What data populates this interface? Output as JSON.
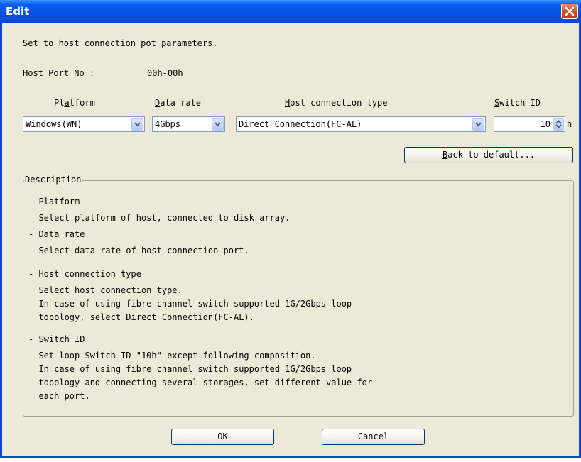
{
  "window": {
    "title": "Edit"
  },
  "instructions": "Set to host connection pot parameters.",
  "host_port": {
    "label": "Host Port No :",
    "value": "00h-00h"
  },
  "platform": {
    "label_pre": "Pl",
    "label_u": "a",
    "label_post": "tform",
    "value": "Windows(WN)"
  },
  "data_rate": {
    "label_u": "D",
    "label_post": "ata rate",
    "value": "4Gbps"
  },
  "host_connection_type": {
    "label_u": "H",
    "label_post": "ost connection type",
    "value": "Direct Connection(FC-AL)"
  },
  "switch_id": {
    "label_u": "S",
    "label_post": "witch ID",
    "value": "10",
    "suffix": "h"
  },
  "back_to_default": {
    "label_u": "B",
    "label_post": "ack to default..."
  },
  "description": {
    "title": "Description",
    "lines": [
      "- Platform",
      "  Select platform of host, connected to disk array.",
      "- Data rate",
      "  Select data rate of host connection port.",
      "- Host connection type",
      "  Select host connection type.",
      "  In case of using fibre channel switch supported 1G/2Gbps loop",
      "  topology, select Direct Connection(FC-AL).",
      "- Switch ID",
      "  Set loop Switch ID \"10h\" except following composition.",
      "  In case of using fibre channel switch supported 1G/2Gbps loop",
      "  topology and connecting several storages, set different value for",
      "  each port."
    ]
  },
  "buttons": {
    "ok": "OK",
    "cancel": "Cancel"
  },
  "icons": {
    "close": "close-icon",
    "dropdown": "chevron-down-icon",
    "spin": "spin-arrows-icon"
  },
  "colors": {
    "titlebar": "#0a5ef0",
    "dialog_bg": "#ece9d8",
    "close": "#d9471e"
  }
}
